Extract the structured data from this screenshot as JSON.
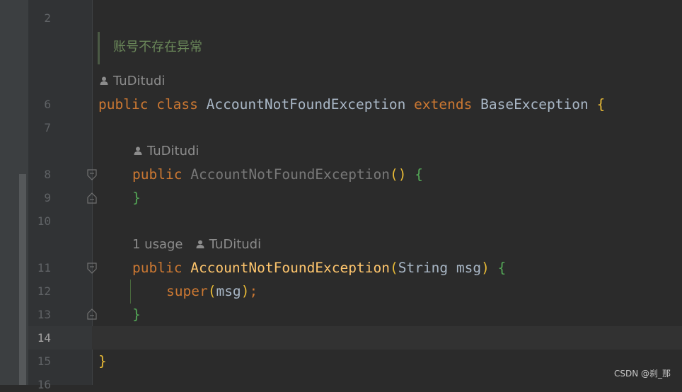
{
  "gutter": {
    "line_numbers": [
      "2",
      "6",
      "7",
      "8",
      "9",
      "10",
      "11",
      "12",
      "13",
      "14",
      "15",
      "16"
    ]
  },
  "doc": {
    "comment": "账号不存在异常"
  },
  "hints": {
    "author": "TuDitudi",
    "usages": "1 usage"
  },
  "code": {
    "kw_public": "public",
    "kw_class": "class",
    "kw_extends": "extends",
    "kw_super": "super",
    "class_name": "AccountNotFoundException",
    "base_class": "BaseException",
    "param_type": "String",
    "param_name": "msg",
    "brace_open": "{",
    "brace_close": "}",
    "paren_open": "(",
    "paren_close": ")",
    "paren_pair": "()",
    "semicolon": ";"
  },
  "watermark": "CSDN @刹_那"
}
